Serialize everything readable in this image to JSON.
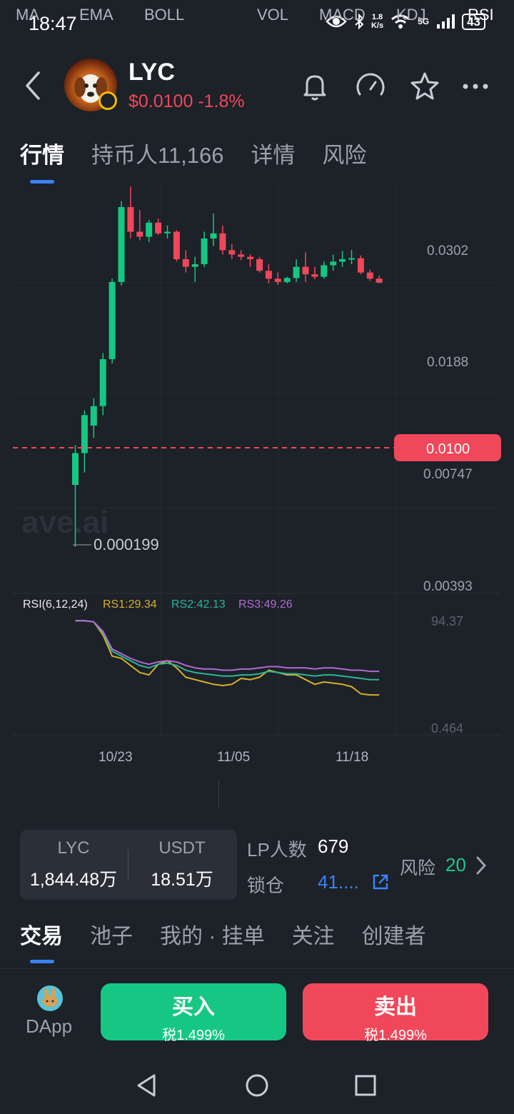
{
  "status_bar": {
    "time": "18:47",
    "net_speed_top": "1.8",
    "net_speed_bottom": "K/s",
    "network": "5G",
    "battery": "43"
  },
  "header": {
    "token_name": "LYC",
    "price": "$0.0100",
    "change": "-1.8%"
  },
  "tabs": [
    {
      "label": "行情",
      "active": true
    },
    {
      "label": "持币人11,166",
      "active": false
    },
    {
      "label": "详情",
      "active": false
    },
    {
      "label": "风险",
      "active": false
    }
  ],
  "chart": {
    "price_labels": [
      "0.0302",
      "0.0188",
      "0.00747",
      "0.00393"
    ],
    "current_price_tag": "0.0100",
    "low_marker": "0.000199",
    "watermark": "ave.ai",
    "rsi": {
      "label": "RSI(6,12,24)",
      "rs1": "RS1:29.34",
      "rs2": "RS2:42.13",
      "rs3": "RS3:49.26",
      "top": "94.37",
      "bottom": "0.464"
    },
    "dates": [
      "10/23",
      "11/05",
      "11/18"
    ],
    "colors": {
      "up": "#16c784",
      "down": "#f0475a",
      "rs1": "#d4b12a",
      "rs2": "#2bb39a",
      "rs3": "#b06ad4"
    }
  },
  "chart_data": {
    "type": "candlestick",
    "interval_note": "",
    "candles": [
      {
        "o": 0.0005,
        "h": 0.0009,
        "l": 0.0002,
        "c": 0.0008
      },
      {
        "o": 0.0008,
        "h": 0.0015,
        "l": 0.0006,
        "c": 0.0014
      },
      {
        "o": 0.0012,
        "h": 0.0018,
        "l": 0.001,
        "c": 0.0016
      },
      {
        "o": 0.0016,
        "h": 0.0035,
        "l": 0.0014,
        "c": 0.0032
      },
      {
        "o": 0.0032,
        "h": 0.0105,
        "l": 0.003,
        "c": 0.01
      },
      {
        "o": 0.01,
        "h": 0.033,
        "l": 0.0095,
        "c": 0.0302
      },
      {
        "o": 0.0302,
        "h": 0.041,
        "l": 0.019,
        "c": 0.021
      },
      {
        "o": 0.021,
        "h": 0.029,
        "l": 0.0185,
        "c": 0.0195
      },
      {
        "o": 0.0195,
        "h": 0.025,
        "l": 0.018,
        "c": 0.024
      },
      {
        "o": 0.024,
        "h": 0.0255,
        "l": 0.02,
        "c": 0.0205
      },
      {
        "o": 0.0205,
        "h": 0.023,
        "l": 0.019,
        "c": 0.021
      },
      {
        "o": 0.021,
        "h": 0.0215,
        "l": 0.0135,
        "c": 0.014
      },
      {
        "o": 0.014,
        "h": 0.016,
        "l": 0.0115,
        "c": 0.0125
      },
      {
        "o": 0.0125,
        "h": 0.0145,
        "l": 0.01,
        "c": 0.013
      },
      {
        "o": 0.013,
        "h": 0.021,
        "l": 0.0125,
        "c": 0.019
      },
      {
        "o": 0.019,
        "h": 0.0275,
        "l": 0.017,
        "c": 0.0205
      },
      {
        "o": 0.0205,
        "h": 0.023,
        "l": 0.015,
        "c": 0.016
      },
      {
        "o": 0.016,
        "h": 0.0175,
        "l": 0.014,
        "c": 0.015
      },
      {
        "o": 0.015,
        "h": 0.016,
        "l": 0.0138,
        "c": 0.0145
      },
      {
        "o": 0.0145,
        "h": 0.015,
        "l": 0.0125,
        "c": 0.014
      },
      {
        "o": 0.014,
        "h": 0.0145,
        "l": 0.0115,
        "c": 0.0118
      },
      {
        "o": 0.0118,
        "h": 0.013,
        "l": 0.0098,
        "c": 0.0105
      },
      {
        "o": 0.0105,
        "h": 0.0115,
        "l": 0.0096,
        "c": 0.01
      },
      {
        "o": 0.01,
        "h": 0.0108,
        "l": 0.0098,
        "c": 0.0106
      },
      {
        "o": 0.0106,
        "h": 0.014,
        "l": 0.01,
        "c": 0.0125
      },
      {
        "o": 0.0125,
        "h": 0.0155,
        "l": 0.01,
        "c": 0.0112
      },
      {
        "o": 0.0112,
        "h": 0.0125,
        "l": 0.0104,
        "c": 0.0108
      },
      {
        "o": 0.0108,
        "h": 0.0135,
        "l": 0.0105,
        "c": 0.0128
      },
      {
        "o": 0.0128,
        "h": 0.015,
        "l": 0.0118,
        "c": 0.0135
      },
      {
        "o": 0.0135,
        "h": 0.0158,
        "l": 0.0125,
        "c": 0.014
      },
      {
        "o": 0.014,
        "h": 0.016,
        "l": 0.013,
        "c": 0.0142
      },
      {
        "o": 0.0142,
        "h": 0.0148,
        "l": 0.0112,
        "c": 0.0115
      },
      {
        "o": 0.0115,
        "h": 0.012,
        "l": 0.0102,
        "c": 0.0105
      },
      {
        "o": 0.0105,
        "h": 0.011,
        "l": 0.0098,
        "c": 0.0099
      }
    ],
    "ylim_labels": [
      "0.0302",
      "0.0188",
      "0.00747",
      "0.00393"
    ],
    "rsi_series": [
      {
        "name": "RS1:29.34",
        "values": [
          92,
          92,
          91,
          80,
          62,
          60,
          54,
          48,
          46,
          55,
          58,
          52,
          44,
          42,
          40,
          38,
          37,
          38,
          43,
          42,
          44,
          50,
          48,
          46,
          46,
          42,
          38,
          40,
          39,
          38,
          36,
          30,
          29,
          29
        ]
      },
      {
        "name": "RS2:42.13",
        "values": [
          92,
          92,
          91,
          82,
          66,
          62,
          58,
          54,
          52,
          55,
          56,
          54,
          50,
          48,
          47,
          46,
          45,
          45,
          46,
          46,
          47,
          49,
          48,
          47,
          47,
          46,
          45,
          46,
          46,
          45,
          44,
          43,
          42,
          42
        ]
      },
      {
        "name": "RS3:49.26",
        "values": [
          92,
          92,
          91,
          83,
          68,
          64,
          60,
          57,
          55,
          57,
          58,
          57,
          54,
          52,
          51,
          51,
          50,
          50,
          51,
          51,
          52,
          53,
          53,
          52,
          52,
          52,
          51,
          52,
          52,
          51,
          50,
          50,
          49,
          49
        ]
      }
    ]
  },
  "indicators": [
    "MA",
    "EMA",
    "BOLL",
    "VOL",
    "MACD",
    "KDJ",
    "RSI"
  ],
  "pool": {
    "token_label": "LYC",
    "token_amount": "1,844.48万",
    "quote_label": "USDT",
    "quote_amount": "18.51万",
    "lp_label": "LP人数",
    "lp_count": "679",
    "lock_label": "锁仓",
    "lock_value": "41....",
    "risk_label": "风险",
    "risk_value": "20"
  },
  "bottom_tabs": [
    {
      "label": "交易",
      "active": true
    },
    {
      "label": "池子",
      "active": false
    },
    {
      "label": "我的 · 挂单",
      "active": false
    },
    {
      "label": "关注",
      "active": false
    },
    {
      "label": "创建者",
      "active": false
    }
  ],
  "actions": {
    "dapp_label": "DApp",
    "buy_label": "买入",
    "buy_tax": "税1.499%",
    "sell_label": "卖出",
    "sell_tax": "税1.499%"
  }
}
